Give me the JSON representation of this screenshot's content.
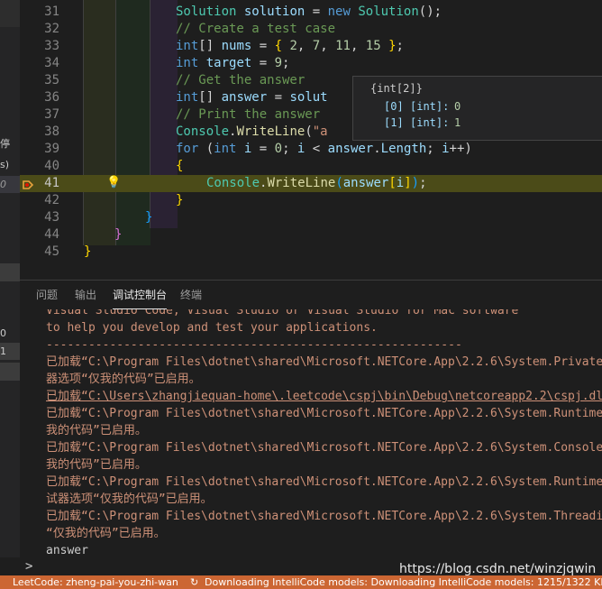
{
  "left_strip": {
    "fragment_1": "停",
    "fragment_2": "s)",
    "fragment_3": "0",
    "fragment_4": "0",
    "fragment_5": "1"
  },
  "editor": {
    "lines": [
      {
        "num": "31",
        "code": "Solution solution = new Solution();"
      },
      {
        "num": "32",
        "code": "// Create a test case"
      },
      {
        "num": "33",
        "code": "int[] nums = { 2, 7, 11, 15 };"
      },
      {
        "num": "34",
        "code": "int target = 9;"
      },
      {
        "num": "35",
        "code": "// Get the answer"
      },
      {
        "num": "36",
        "code": "int[] answer = solut"
      },
      {
        "num": "37",
        "code": "// Print the answer"
      },
      {
        "num": "38",
        "code": "Console.WriteLine(\"a"
      },
      {
        "num": "39",
        "code": "for (int i = 0; i < answer.Length; i++)"
      },
      {
        "num": "40",
        "code": "{"
      },
      {
        "num": "41",
        "code": "Console.WriteLine(answer[i]);"
      },
      {
        "num": "42",
        "code": "}"
      },
      {
        "num": "43",
        "code": "}"
      },
      {
        "num": "44",
        "code": "}"
      },
      {
        "num": "45",
        "code": "}"
      }
    ],
    "hover": {
      "title": "{int[2]}",
      "items": [
        {
          "index": "[0]",
          "type": "[int]:",
          "value": "0"
        },
        {
          "index": "[1]",
          "type": "[int]:",
          "value": "1"
        }
      ]
    }
  },
  "panel": {
    "tabs": [
      "问题",
      "输出",
      "调试控制台",
      "终端"
    ],
    "active_tab": "调试控制台",
    "console_lines": [
      "Visual Studio Code, Visual Studio or Visual Studio for Mac software",
      "to help you develop and test your applications.",
      "-----------------------------------------------------------",
      "已加载“C:\\Program Files\\dotnet\\shared\\Microsoft.NETCore.App\\2.2.6\\System.Private.",
      "器选项“仅我的代码”已启用。",
      "已加载“C:\\Users\\zhangjiequan-home\\.leetcode\\cspj\\bin\\Debug\\netcoreapp2.2\\cspj.dll",
      "已加载“C:\\Program Files\\dotnet\\shared\\Microsoft.NETCore.App\\2.2.6\\System.Runtime.",
      "我的代码”已启用。",
      "已加载“C:\\Program Files\\dotnet\\shared\\Microsoft.NETCore.App\\2.2.6\\System.Console.",
      "我的代码”已启用。",
      "已加载“C:\\Program Files\\dotnet\\shared\\Microsoft.NETCore.App\\2.2.6\\System.Runtime.",
      "试器选项“仅我的代码”已启用。",
      "已加载“C:\\Program Files\\dotnet\\shared\\Microsoft.NETCore.App\\2.2.6\\System.Threadin",
      "“仅我的代码”已启用。",
      "answer"
    ],
    "prompt_symbol": ">"
  },
  "status_bar": {
    "left": "LeetCode: zheng-pai-you-zhi-wan",
    "sync_icon": "sync-icon",
    "downloading": "Downloading IntelliCode models: Downloading IntelliCode models: 1215/1322 KB (9"
  },
  "watermark": "https://blog.csdn.net/winzjqwin",
  "colors": {
    "status_bg": "#cc6633",
    "current_line_bg": "#4b4b18",
    "console_text": "#ce9178"
  }
}
